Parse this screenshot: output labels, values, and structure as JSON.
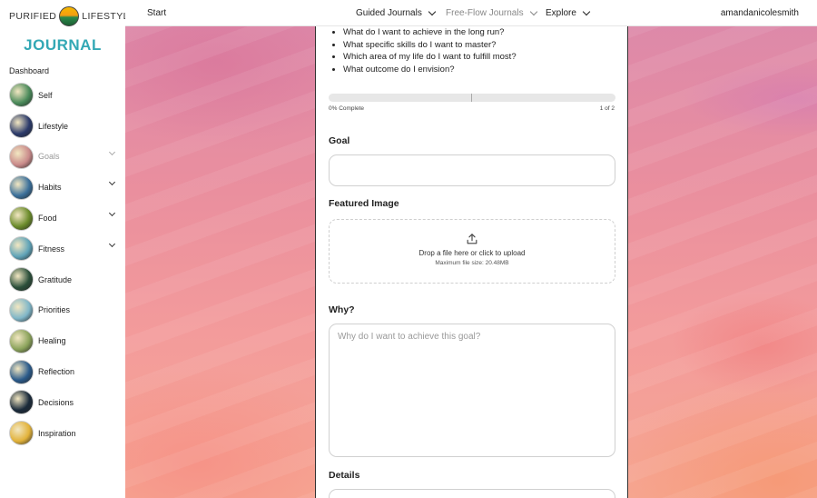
{
  "logo": {
    "left": "PURIFIED",
    "right": "LIFESTYLE"
  },
  "sidebar": {
    "title": "JOURNAL",
    "dashboard": "Dashboard",
    "items": [
      {
        "label": "Self",
        "color": "#4a8a5a",
        "dim": false,
        "chevron": false
      },
      {
        "label": "Lifestyle",
        "color": "#2b3a6a",
        "dim": false,
        "chevron": false
      },
      {
        "label": "Goals",
        "color": "#c98a8a",
        "dim": true,
        "chevron": true
      },
      {
        "label": "Habits",
        "color": "#3a6f9a",
        "dim": false,
        "chevron": true
      },
      {
        "label": "Food",
        "color": "#6a8a2a",
        "dim": false,
        "chevron": true
      },
      {
        "label": "Fitness",
        "color": "#5fa3b8",
        "dim": false,
        "chevron": true
      },
      {
        "label": "Gratitude",
        "color": "#2b4f3a",
        "dim": false,
        "chevron": false
      },
      {
        "label": "Priorities",
        "color": "#7fb6c8",
        "dim": false,
        "chevron": false
      },
      {
        "label": "Healing",
        "color": "#8aa25a",
        "dim": false,
        "chevron": false
      },
      {
        "label": "Reflection",
        "color": "#2a5a8a",
        "dim": false,
        "chevron": false
      },
      {
        "label": "Decisions",
        "color": "#1a2a3a",
        "dim": false,
        "chevron": false
      },
      {
        "label": "Inspiration",
        "color": "#e2b23a",
        "dim": false,
        "chevron": false
      }
    ]
  },
  "topbar": {
    "start": "Start",
    "guided": "Guided Journals",
    "freeflow": "Free-Flow Journals",
    "explore": "Explore",
    "user": "amandanicolesmith"
  },
  "form": {
    "bullets": [
      "What do I want to achieve in the long run?",
      "What specific skills do I want to master?",
      "Which area of my life do I want to fulfill most?",
      "What outcome do I envision?"
    ],
    "progress_fraction": 0,
    "progress_label": "0% Complete",
    "page_label": "1 of 2",
    "goal_label": "Goal",
    "goal_value": "",
    "image_label": "Featured Image",
    "upload_text": "Drop a file here or click to upload",
    "upload_sub": "Maximum file size: 20.48MB",
    "why_label": "Why?",
    "why_placeholder": "Why do I want to achieve this goal?",
    "details_label": "Details"
  }
}
